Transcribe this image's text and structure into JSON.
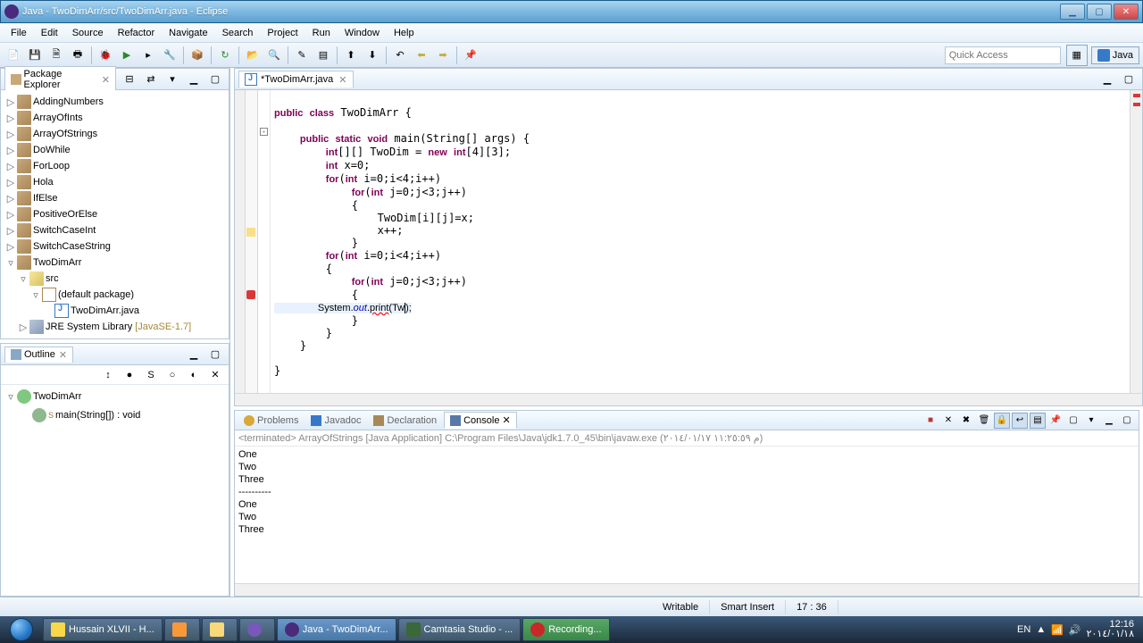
{
  "window": {
    "title": "Java - TwoDimArr/src/TwoDimArr.java - Eclipse"
  },
  "menu": [
    "File",
    "Edit",
    "Source",
    "Refactor",
    "Navigate",
    "Search",
    "Project",
    "Run",
    "Window",
    "Help"
  ],
  "quickAccess": "Quick Access",
  "perspective": "Java",
  "packageExplorer": {
    "title": "Package Explorer",
    "projects": [
      "AddingNumbers",
      "ArrayOfInts",
      "ArrayOfStrings",
      "DoWhile",
      "ForLoop",
      "Hola",
      "IfElse",
      "PositiveOrElse",
      "SwitchCaseInt",
      "SwitchCaseString"
    ],
    "openProject": {
      "name": "TwoDimArr",
      "src": "src",
      "pkg": "(default package)",
      "file": "TwoDimArr.java",
      "lib": "JRE System Library",
      "libSuffix": "[JavaSE-1.7]"
    }
  },
  "outline": {
    "title": "Outline",
    "class": "TwoDimArr",
    "method": "main(String[]) : void"
  },
  "editor": {
    "tabTitle": "*TwoDimArr.java"
  },
  "bottomTabs": {
    "problems": "Problems",
    "javadoc": "Javadoc",
    "declaration": "Declaration",
    "console": "Console"
  },
  "console": {
    "header": "<terminated> ArrayOfStrings [Java Application] C:\\Program Files\\Java\\jdk1.7.0_45\\bin\\javaw.exe (م ١١:٢٥:٥٩ ٢٠١٤/٠١/١٧)",
    "lines": [
      "One",
      "Two",
      "Three",
      "----------",
      "One",
      "Two",
      "Three"
    ]
  },
  "status": {
    "writable": "Writable",
    "insert": "Smart Insert",
    "pos": "17 : 36"
  },
  "taskbar": {
    "items": [
      {
        "label": "Hussain XLVII - H...",
        "color": "#f8d848"
      },
      {
        "label": "",
        "color": "#f89838"
      },
      {
        "label": "",
        "color": "#f8d878"
      },
      {
        "label": "",
        "color": "#7858b8"
      },
      {
        "label": "Java - TwoDimArr...",
        "color": "#4a2a7a",
        "active": true
      },
      {
        "label": "Camtasia Studio - ...",
        "color": "#3a6838"
      },
      {
        "label": "Recording...",
        "color": "#c82828",
        "rec": true
      }
    ],
    "lang": "EN",
    "time": "12:16",
    "date": "٢٠١٤/٠١/١٨"
  }
}
